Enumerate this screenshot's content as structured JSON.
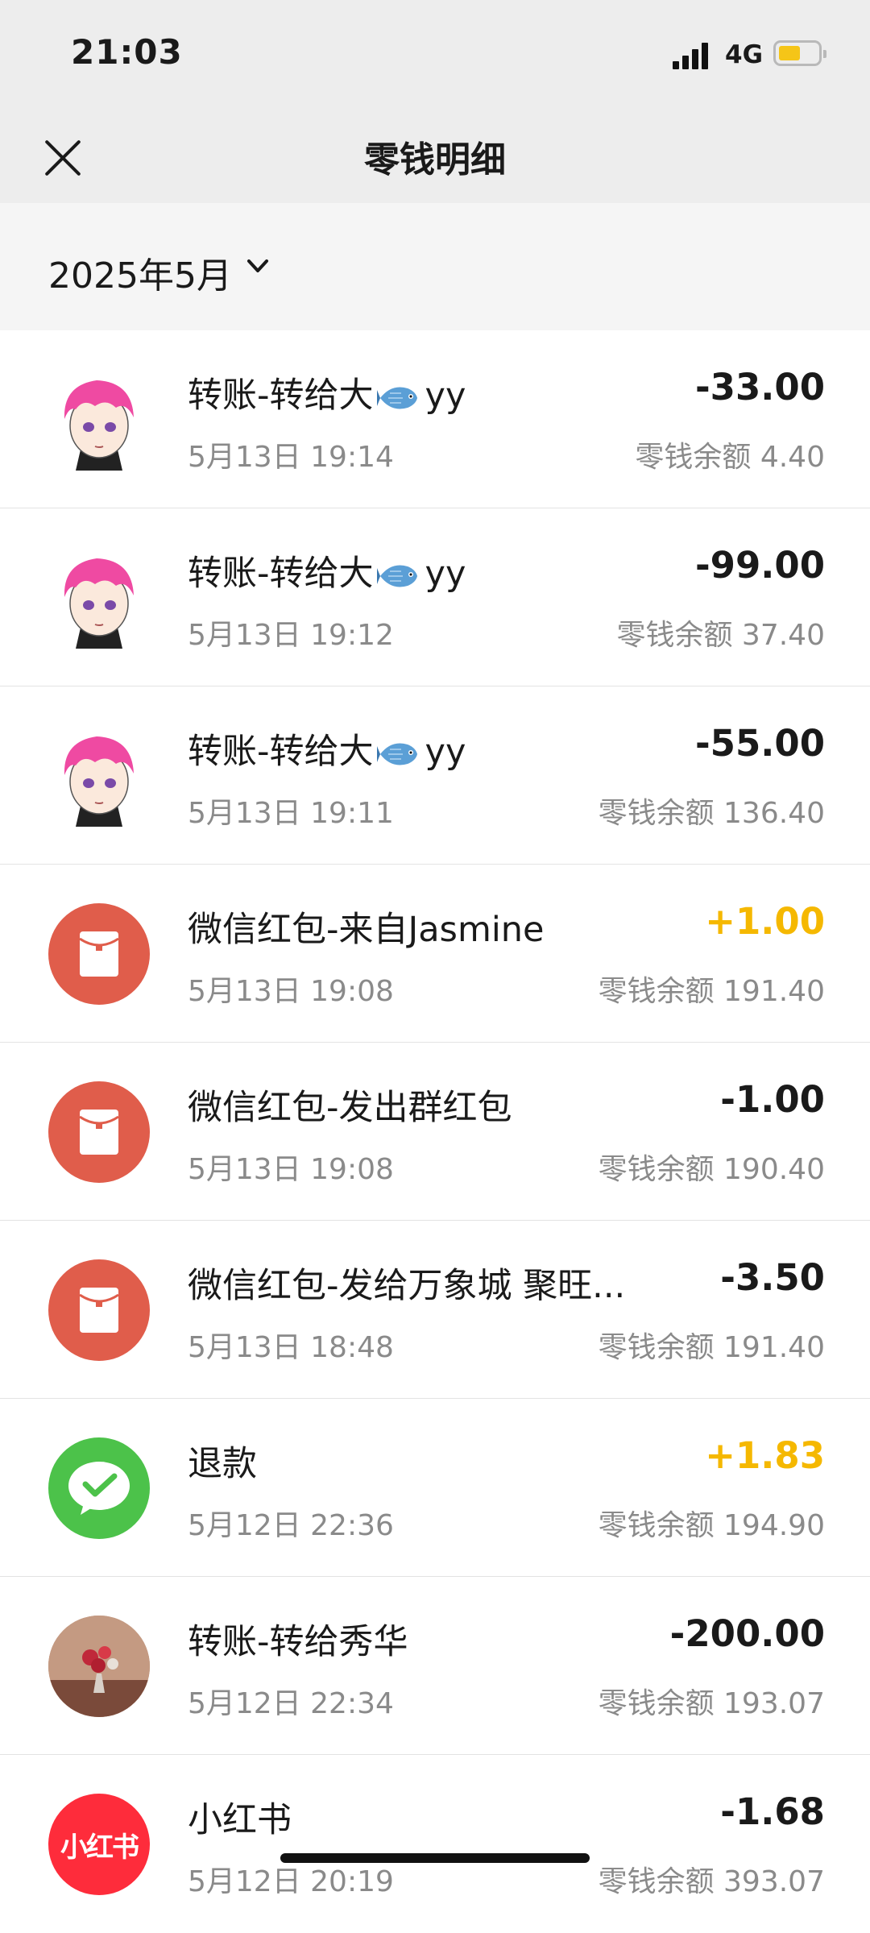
{
  "status": {
    "time": "21:03",
    "network": "4G"
  },
  "header": {
    "title": "零钱明细"
  },
  "filter": {
    "month": "2025年5月"
  },
  "transactions": [
    {
      "name_prefix": "转账-转给大",
      "name_suffix": "yy",
      "icon": "anime-avatar",
      "date": "5月13日 19:14",
      "amount": "-33.00",
      "balance": "零钱余额 4.40"
    },
    {
      "name_prefix": "转账-转给大",
      "name_suffix": "yy",
      "icon": "anime-avatar",
      "date": "5月13日 19:12",
      "amount": "-99.00",
      "balance": "零钱余额 37.40"
    },
    {
      "name_prefix": "转账-转给大",
      "name_suffix": "yy",
      "icon": "anime-avatar",
      "date": "5月13日 19:11",
      "amount": "-55.00",
      "balance": "零钱余额 136.40"
    },
    {
      "name": "微信红包-来自Jasmine",
      "icon": "red-packet-icon",
      "date": "5月13日 19:08",
      "amount": "+1.00",
      "balance": "零钱余额 191.40"
    },
    {
      "name": "微信红包-发出群红包",
      "icon": "red-packet-icon",
      "date": "5月13日 19:08",
      "amount": "-1.00",
      "balance": "零钱余额 190.40"
    },
    {
      "name": "微信红包-发给万象城 聚旺...",
      "icon": "red-packet-icon",
      "date": "5月13日 18:48",
      "amount": "-3.50",
      "balance": "零钱余额 191.40"
    },
    {
      "name": "退款",
      "icon": "wechat-pay-icon",
      "date": "5月12日 22:36",
      "amount": "+1.83",
      "balance": "零钱余额 194.90"
    },
    {
      "name": "转账-转给秀华",
      "icon": "photo-avatar",
      "date": "5月12日 22:34",
      "amount": "-200.00",
      "balance": "零钱余额 193.07"
    },
    {
      "name": "小红书",
      "icon": "xiaohongshu-logo",
      "logo_text": "小红书",
      "date": "5月12日 20:19",
      "amount": "-1.68",
      "balance": "零钱余额 393.07"
    }
  ],
  "colors": {
    "positive": "#f5b800",
    "red_packet": "#e05d4b",
    "wechat_green": "#4cc24a",
    "xhs_red": "#fe2c3b"
  }
}
